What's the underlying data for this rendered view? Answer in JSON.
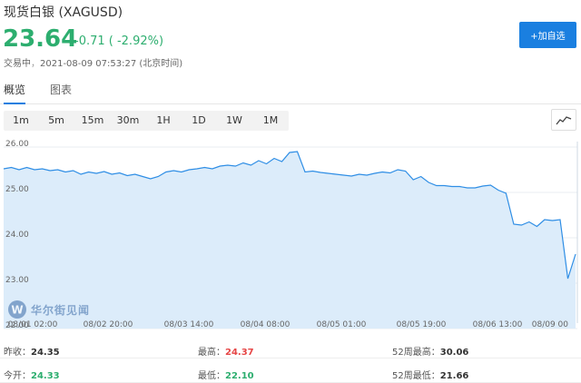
{
  "header": {
    "title": "现货白银 (XAGUSD)",
    "price": "23.64",
    "change": "-0.71 ( -2.92%)",
    "status_label": "交易中",
    "timestamp": "2021-08-09 07:53:27 (北京时间)",
    "add_button": "+加自选"
  },
  "tabs": [
    {
      "label": "概览",
      "active": true
    },
    {
      "label": "图表",
      "active": false
    }
  ],
  "periods": [
    "1m",
    "5m",
    "15m",
    "30m",
    "1H",
    "1D",
    "1W",
    "1M"
  ],
  "chart_data": {
    "type": "area",
    "y_ticks": [
      "26.00",
      "25.00",
      "24.00",
      "23.00",
      "22.00"
    ],
    "ylim": [
      22.0,
      26.0
    ],
    "x_ticks": [
      "08/01 02:00",
      "08/02 20:00",
      "08/03 14:00",
      "08/04 08:00",
      "08/05 01:00",
      "08/05 19:00",
      "08/06 13:00",
      "08/09 00"
    ],
    "values": [
      25.52,
      25.55,
      25.5,
      25.55,
      25.5,
      25.52,
      25.48,
      25.5,
      25.45,
      25.48,
      25.4,
      25.45,
      25.42,
      25.46,
      25.4,
      25.43,
      25.37,
      25.4,
      25.35,
      25.3,
      25.35,
      25.45,
      25.48,
      25.45,
      25.5,
      25.52,
      25.55,
      25.52,
      25.58,
      25.6,
      25.58,
      25.65,
      25.6,
      25.7,
      25.63,
      25.75,
      25.68,
      25.88,
      25.9,
      25.45,
      25.47,
      25.44,
      25.42,
      25.4,
      25.38,
      25.36,
      25.4,
      25.38,
      25.42,
      25.45,
      25.43,
      25.5,
      25.47,
      25.28,
      25.35,
      25.22,
      25.15,
      25.15,
      25.13,
      25.13,
      25.1,
      25.1,
      25.14,
      25.16,
      25.05,
      24.98,
      24.3,
      24.28,
      24.35,
      24.25,
      24.4,
      24.38,
      24.4,
      23.1,
      23.64
    ],
    "line_color": "#2f8ee5",
    "fill_color": "#dcecfa",
    "grid": true
  },
  "watermark": {
    "text": "华尔街见闻"
  },
  "stats": [
    {
      "label": "昨收：",
      "value": "24.35",
      "tone": "neutral"
    },
    {
      "label": "最高：",
      "value": "24.37",
      "tone": "up"
    },
    {
      "label": "52周最高：",
      "value": "30.06",
      "tone": "neutral"
    },
    {
      "label": "今开：",
      "value": "24.33",
      "tone": "down"
    },
    {
      "label": "最低：",
      "value": "22.10",
      "tone": "down"
    },
    {
      "label": "52周最低：",
      "value": "21.66",
      "tone": "neutral"
    }
  ],
  "colors": {
    "accent": "#1a7fe0",
    "down": "#2dae6f",
    "up": "#e64545"
  }
}
